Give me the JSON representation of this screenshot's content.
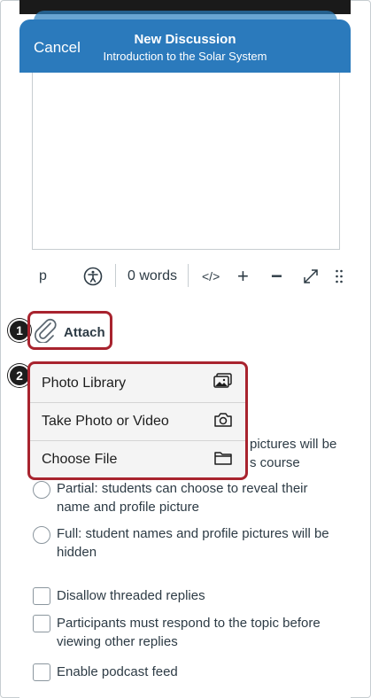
{
  "header": {
    "cancel_label": "Cancel",
    "title": "New Discussion",
    "subtitle": "Introduction to the Solar System"
  },
  "toolbar": {
    "paragraph_label": "p",
    "word_count": "0 words",
    "code_label": "</>",
    "plus_label": "+",
    "minus_label": "−",
    "icons": [
      "accessibility-icon",
      "code-view-icon",
      "zoom-in-icon",
      "zoom-out-icon",
      "fullscreen-icon",
      "more-vertical-icon"
    ]
  },
  "attach": {
    "label": "Attach",
    "icon": "paperclip-icon"
  },
  "callouts": [
    "1",
    "2"
  ],
  "attach_menu": [
    {
      "label": "Photo Library",
      "icon": "photo-library-icon"
    },
    {
      "label": "Take Photo or Video",
      "icon": "camera-icon"
    },
    {
      "label": "Choose File",
      "icon": "folder-icon"
    }
  ],
  "anonymity_options": {
    "off_partial_line1": "pictures will be",
    "off_partial_line2": "s course",
    "partial_line1": "Partial: students can choose to reveal their",
    "partial_line2": "name and profile picture",
    "full_line1": "Full: student names and profile pictures will be",
    "full_line2": "hidden"
  },
  "checkboxes": {
    "disallow_threaded": "Disallow threaded replies",
    "must_respond_line1": "Participants must respond to the topic before",
    "must_respond_line2": "viewing other replies",
    "podcast_feed": "Enable podcast feed"
  },
  "colors": {
    "header_blue": "#2b7abc",
    "highlight_red": "#a8232e",
    "text": "#2d3b45"
  }
}
